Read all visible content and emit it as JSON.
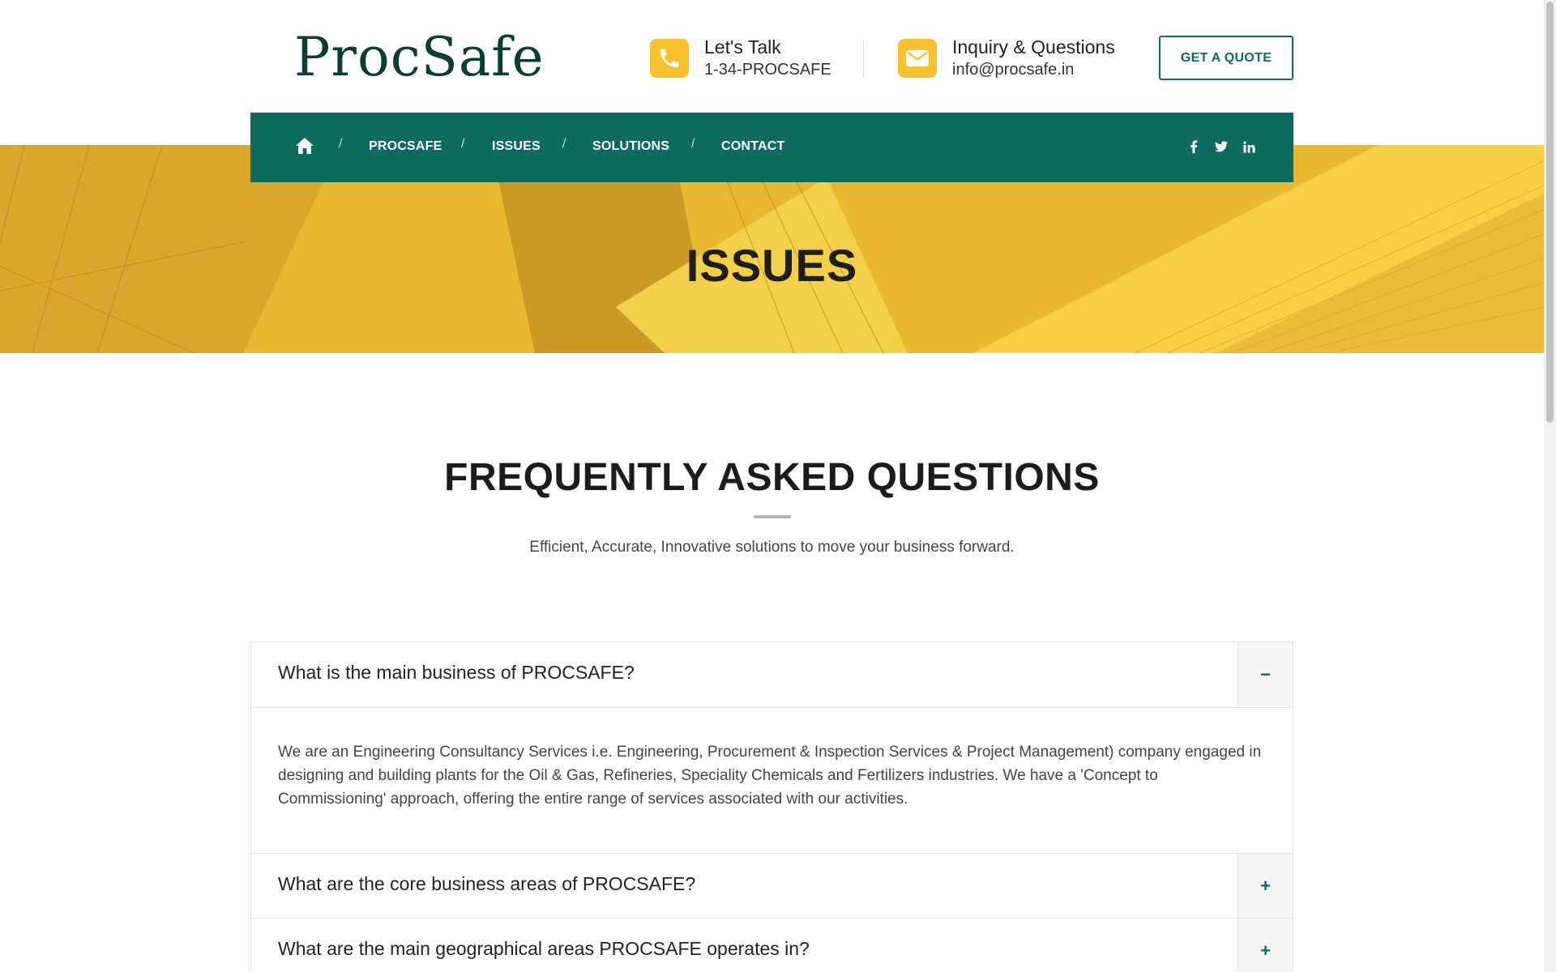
{
  "brand": {
    "logo_text": "ProcSafe",
    "accent": "#0d6b60",
    "highlight": "#f9c12c"
  },
  "header": {
    "talk": {
      "icon": "phone-icon",
      "label": "Let's Talk",
      "value": "1-34-PROCSAFE"
    },
    "inquiry": {
      "icon": "envelope-icon",
      "label": "Inquiry & Questions",
      "value": "info@procsafe.in"
    },
    "quote_button": "GET A QUOTE"
  },
  "nav": {
    "home_icon": "home-icon",
    "items": [
      "PROCSAFE",
      "ISSUES",
      "SOLUTIONS",
      "CONTACT"
    ],
    "separator": "/",
    "social_icons": [
      "facebook-icon",
      "twitter-icon",
      "linkedin-icon"
    ]
  },
  "hero": {
    "title": "ISSUES"
  },
  "faq": {
    "title": "FREQUENTLY ASKED QUESTIONS",
    "subtitle": "Efficient, Accurate, Innovative solutions to move your business forward.",
    "items": [
      {
        "question": "What is the main business of PROCSAFE?",
        "toggle": "−",
        "expanded": true,
        "answer": "We are an Engineering Consultancy Services i.e. Engineering, Procurement & Inspection Services & Project Management) company engaged in designing and building plants for the Oil & Gas, Refineries, Speciality Chemicals and Fertilizers industries. We have a 'Concept to Commissioning' approach, offering the entire range of services associated with our activities."
      },
      {
        "question": "What are the core business areas of PROCSAFE?",
        "toggle": "+",
        "expanded": false
      },
      {
        "question": "What are the main geographical areas PROCSAFE operates in?",
        "toggle": "+",
        "expanded": false
      }
    ]
  }
}
